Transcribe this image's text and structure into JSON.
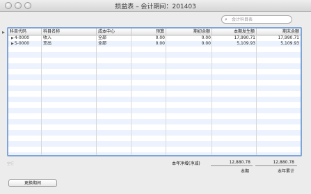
{
  "window": {
    "title": "损益表 – 会计期间：201403"
  },
  "search": {
    "placeholder": "会计科目表"
  },
  "table": {
    "columns": [
      "科目代码",
      "科目名称",
      "成本中心",
      "预算",
      "期初余额",
      "本期发生额",
      "期末余额"
    ],
    "rows": [
      {
        "code": "4-0000",
        "name": "收入",
        "center": "全部",
        "budget": "0.00",
        "opening": "0.00",
        "period": "17,990.71",
        "closing": "17,990.71"
      },
      {
        "code": "5-0000",
        "name": "支出",
        "center": "全部",
        "budget": "0.00",
        "opening": "0.00",
        "period": "5,109.93",
        "closing": "5,109.93"
      }
    ]
  },
  "status": {
    "left_text": "空行"
  },
  "summary": {
    "label": "本年净增(净减)",
    "period_value": "12,880.78",
    "ytd_value": "12,880.78",
    "period_caption": "本期",
    "ytd_caption": "本年累计"
  },
  "footer": {
    "change_period_label": "更换期间"
  }
}
